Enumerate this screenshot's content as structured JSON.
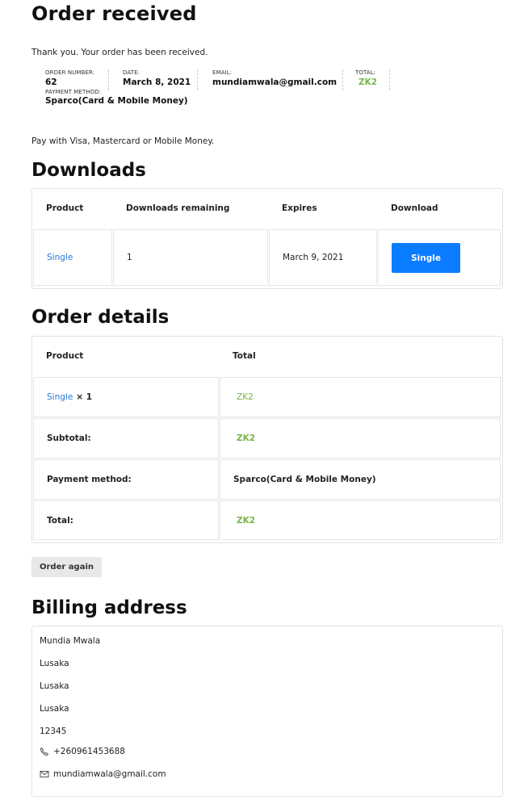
{
  "page": {
    "title": "Order received",
    "thanks": "Thank you. Your order has been received.",
    "pay_note": "Pay with Visa, Mastercard or Mobile Money."
  },
  "overview": {
    "order_number_label": "ORDER NUMBER:",
    "order_number": "62",
    "date_label": "DATE:",
    "date": "March 8, 2021",
    "email_label": "EMAIL:",
    "email": "mundiamwala@gmail.com",
    "total_label": "TOTAL:",
    "total": "ZK2",
    "payment_label": "PAYMENT METHOD:",
    "payment": "Sparco(Card & Mobile Money)"
  },
  "downloads": {
    "heading": "Downloads",
    "headers": [
      "Product",
      "Downloads remaining",
      "Expires",
      "Download"
    ],
    "row": {
      "product": "Single",
      "remaining": "1",
      "expires": "March 9, 2021",
      "button": "Single"
    }
  },
  "order_details": {
    "heading": "Order details",
    "headers": [
      "Product",
      "Total"
    ],
    "item": {
      "product": "Single",
      "qty": "× 1",
      "total": "ZK2"
    },
    "subtotal_label": "Subtotal:",
    "subtotal": "ZK2",
    "payment_label": "Payment method:",
    "payment": "Sparco(Card & Mobile Money)",
    "total_label": "Total:",
    "total": "ZK2"
  },
  "order_again": "Order again",
  "billing": {
    "heading": "Billing address",
    "lines": [
      "Mundia Mwala",
      "Lusaka",
      "Lusaka",
      "Lusaka",
      "12345"
    ],
    "phone": "+260961453688",
    "email": "mundiamwala@gmail.com"
  },
  "colors": {
    "accent": "#0a7cff",
    "price": "#7ab548",
    "link": "#2a78d6"
  },
  "icons": {
    "phone": "phone-icon",
    "email": "envelope-icon"
  }
}
